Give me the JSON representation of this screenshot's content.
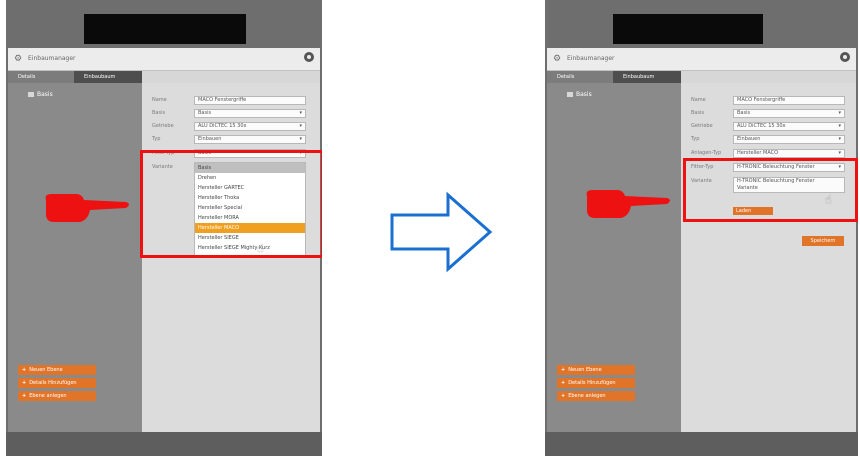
{
  "colors": {
    "accent_orange": "#e07428",
    "highlight_red": "#ee1111",
    "dropdown_selected": "#f0a020",
    "arrow_blue": "#1a6fd0"
  },
  "icons": {
    "gear": "gear-icon",
    "pointing_hand": "pointing-hand-icon",
    "cursor": "hand-cursor-icon",
    "transition_arrow": "right-arrow-icon"
  },
  "before": {
    "title": "Einbaumanager",
    "tabs": [
      "Details",
      "Einbaubaum"
    ],
    "tree_item": "Basis",
    "labels": {
      "name": "Name",
      "basis": "Basis",
      "getriebe": "Getriebe",
      "typ": "Typ",
      "fitter_typ": "Fitter-Typ",
      "variante": "Variante"
    },
    "fields": {
      "name": "MACO Fenstergriffe",
      "basis": "Basis",
      "getriebe": "ALU DiCTEC 15 30x",
      "typ": "Einbauen",
      "fitter_typ": "Basis"
    },
    "dropdown_options": [
      "Basis",
      "Drehen",
      "Hersteller GARTEC",
      "Hersteller Thoka",
      "Hersteller Special",
      "Hersteller MORA",
      "Hersteller MACO",
      "Hersteller SIEGE",
      "Hersteller SIEGE Mighty Kurz"
    ],
    "buttons": [
      "Neuen Ebene",
      "Details Hinzufügen",
      "Ebene anlegen"
    ]
  },
  "after": {
    "title": "Einbaumanager",
    "tabs": [
      "Details",
      "Einbaubaum"
    ],
    "tree_item": "Basis",
    "labels": {
      "name": "Name",
      "basis": "Basis",
      "getriebe": "Getriebe",
      "typ": "Typ",
      "anlagen_typ": "Anlagen-Typ",
      "fitter_typ": "Fitter-Typ",
      "variante": "Variante"
    },
    "fields": {
      "name": "MACO Fenstergriffe",
      "basis": "Basis",
      "getriebe": "ALU DiCTEC 15 30x",
      "typ": "Einbauen",
      "anlagen_typ": "Hersteller MACO",
      "fitter_typ": "H-TRONIC Beleuchtung Fenster",
      "variante": "H-TRONIC Beleuchtung Fenster"
    },
    "variante_sub": "Variante",
    "small_button": "Laden",
    "action_button": "Speichern",
    "buttons": [
      "Neuen Ebene",
      "Details Hinzufügen",
      "Ebene anlegen"
    ]
  }
}
